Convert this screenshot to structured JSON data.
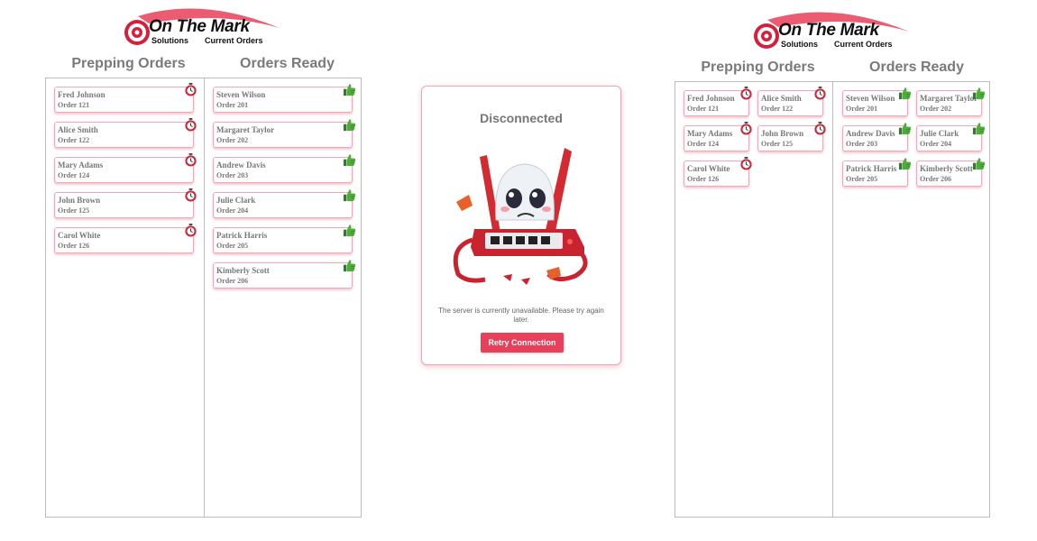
{
  "logo": {
    "brand": "On The Mark",
    "sub_left": "Solutions",
    "sub_right": "Current Orders"
  },
  "columns": {
    "prepping": "Prepping Orders",
    "ready": "Orders Ready"
  },
  "prepping_orders": [
    {
      "name": "Fred Johnson",
      "order": "Order 121"
    },
    {
      "name": "Alice Smith",
      "order": "Order 122"
    },
    {
      "name": "Mary Adams",
      "order": "Order 124"
    },
    {
      "name": "John Brown",
      "order": "Order 125"
    },
    {
      "name": "Carol White",
      "order": "Order 126"
    }
  ],
  "ready_orders": [
    {
      "name": "Steven Wilson",
      "order": "Order 201"
    },
    {
      "name": "Margaret Taylor",
      "order": "Order 202"
    },
    {
      "name": "Andrew Davis",
      "order": "Order 203"
    },
    {
      "name": "Julie Clark",
      "order": "Order 204"
    },
    {
      "name": "Patrick Harris",
      "order": "Order 205"
    },
    {
      "name": "Kimberly Scott",
      "order": "Order 206"
    }
  ],
  "modal": {
    "title": "Disconnected",
    "message": "The server is currently unavailable. Please try again later.",
    "retry_label": "Retry Connection"
  },
  "icons": {
    "prepping": "stopwatch-icon",
    "ready": "thumbs-up-icon",
    "illustration": "broken-router-illustration"
  },
  "colors": {
    "accent": "#e8405a",
    "card_border": "#f1a9b6",
    "title_gray": "#7a7a7a",
    "thumb_green": "#4caf3a"
  }
}
